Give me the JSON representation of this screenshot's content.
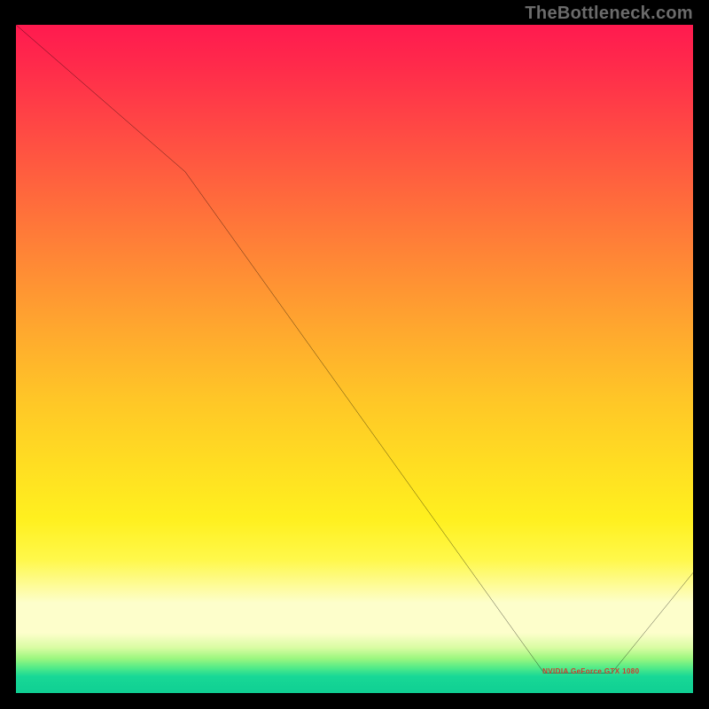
{
  "watermark": "TheBottleneck.com",
  "annotation_label": "NVIDIA GeForce GTX 1080",
  "chart_data": {
    "type": "line",
    "title": "",
    "xlabel": "",
    "ylabel": "",
    "xlim": [
      0,
      100
    ],
    "ylim": [
      0,
      100
    ],
    "series": [
      {
        "name": "bottleneck-curve",
        "x": [
          0,
          25,
          78,
          88,
          100
        ],
        "y": [
          100,
          78,
          3,
          3,
          18
        ]
      }
    ],
    "annotations": [
      {
        "label_key": "annotation_label",
        "x": 83,
        "y": 3
      }
    ],
    "background_gradient": {
      "direction": "vertical",
      "stops": [
        {
          "pos": 0,
          "color": "#ff1a4f"
        },
        {
          "pos": 0.36,
          "color": "#ff8a35"
        },
        {
          "pos": 0.66,
          "color": "#ffde22"
        },
        {
          "pos": 0.88,
          "color": "#fdfecb"
        },
        {
          "pos": 1.0,
          "color": "#0fcf93"
        }
      ]
    }
  }
}
